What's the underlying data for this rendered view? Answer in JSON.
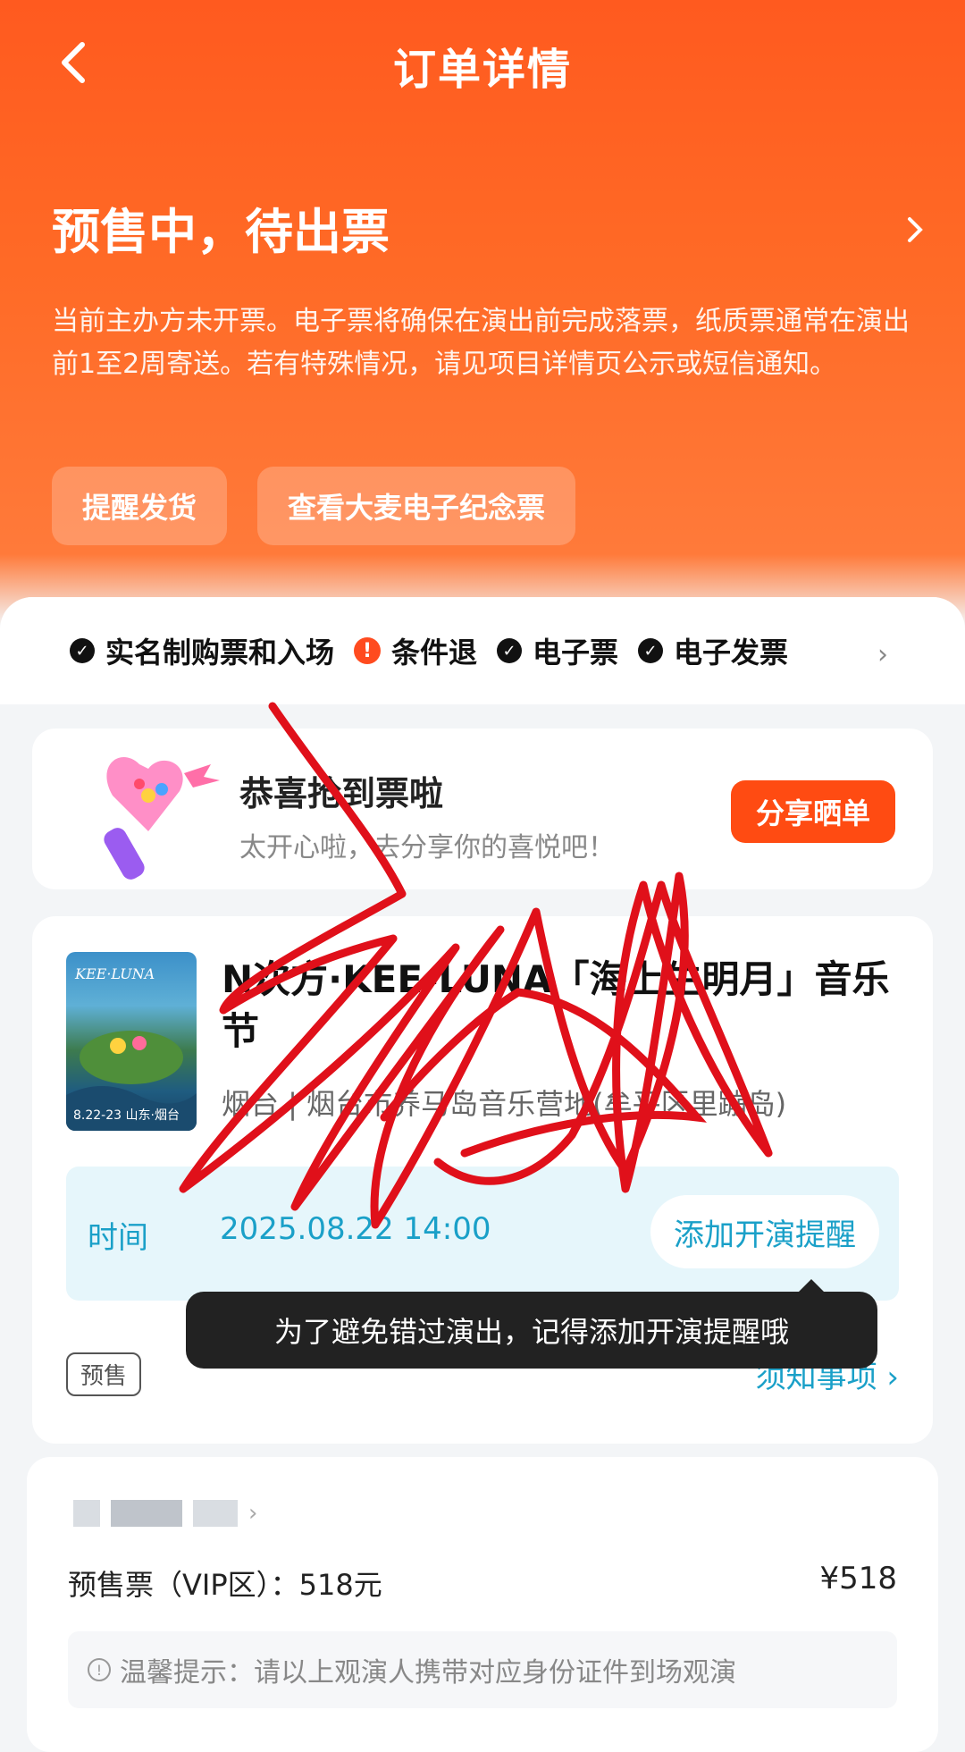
{
  "header": {
    "title": "订单详情"
  },
  "status": {
    "title": "预售中，待出票",
    "description": "当前主办方未开票。电子票将确保在演出前完成落票，纸质票通常在演出前1至2周寄送。若有特殊情况，请见项目详情页公示或短信通知。"
  },
  "actions": {
    "remind_ship": "提醒发货",
    "view_ticket": "查看大麦电子纪念票"
  },
  "tags": [
    {
      "label": "实名制购票和入场",
      "icon": "check-icon"
    },
    {
      "label": "条件退",
      "icon": "warning-icon"
    },
    {
      "label": "电子票",
      "icon": "check-icon"
    },
    {
      "label": "电子发票",
      "icon": "check-icon"
    }
  ],
  "congrats": {
    "title": "恭喜抢到票啦",
    "subtitle": "太开心啦，去分享你的喜悦吧！",
    "share_label": "分享晒单"
  },
  "event": {
    "title": "N次方·KEE-LUNA「海上生明月」音乐节",
    "venue": "烟台 | 烟台市养马岛音乐营地(牟平区里蹦岛)",
    "time_label": "时间",
    "time_value": "2025.08.22 14:00",
    "remind_label": "添加开演提醒",
    "tooltip": "为了避免错过演出，记得添加开演提醒哦",
    "presale_tag": "预售",
    "notice_label": "须知事项",
    "poster_text": "8.22-23 山东·烟台"
  },
  "ticket": {
    "line": "预售票（VIP区）：518元",
    "price": "¥518",
    "tip": "温馨提示：请以上观演人携带对应身份证件到场观演"
  },
  "colors": {
    "brand": "#ff5a1f",
    "accent_blue": "#1aa0c8",
    "scribble": "#e0101a"
  }
}
